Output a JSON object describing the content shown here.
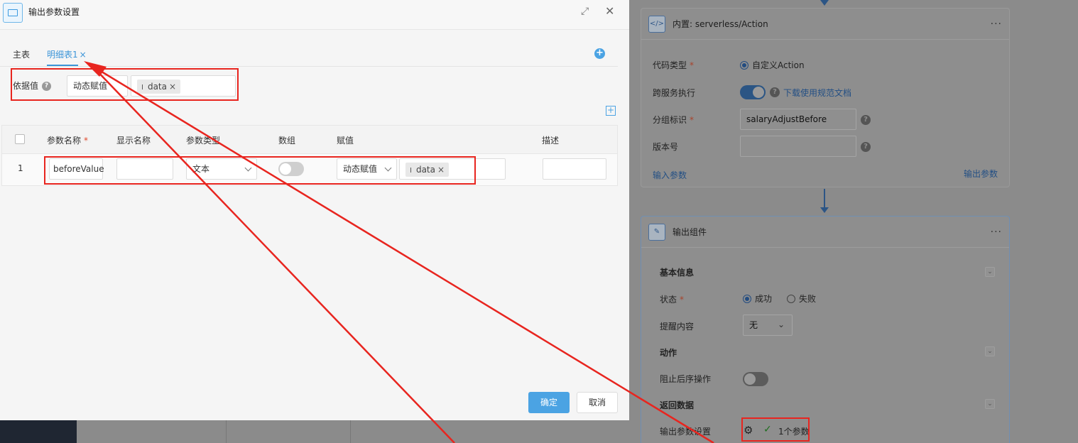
{
  "colors": {
    "accent": "#4ba3e3",
    "annotation": "#e8251f",
    "active_blue": "#3c95d8"
  },
  "modal": {
    "title": "输出参数设置",
    "expand_icon": "expand-icon",
    "close_icon": "close-icon",
    "tabs": [
      {
        "label": "主表"
      },
      {
        "label": "明细表1",
        "close": "×"
      }
    ],
    "add_icon": "+",
    "dependency": {
      "label": "依据值",
      "help": "?",
      "mode": "动态赋值",
      "tag": "data",
      "tag_close": "×"
    },
    "add_row_icon": "+",
    "table": {
      "headers": [
        "参数名称",
        "显示名称",
        "参数类型",
        "数组",
        "赋值",
        "描述"
      ],
      "required_mark": "*",
      "rows": [
        {
          "index": "1",
          "name": "beforeValue",
          "display_name": "",
          "type": "文本",
          "array": false,
          "assign_mode": "动态赋值",
          "assign_tag": "data",
          "assign_close": "×",
          "description": ""
        }
      ]
    },
    "ok_label": "确定",
    "cancel_label": "取消"
  },
  "background": {
    "action_card": {
      "icon_text": "</>",
      "title": "内置: serverless/Action",
      "more": "···",
      "code_type_label": "代码类型",
      "code_type_value": "自定义Action",
      "cross_service_label": "跨服务执行",
      "cross_service_on": true,
      "download_link": "下载使用规范文档",
      "group_label": "分组标识",
      "group_value": "salaryAdjustBefore",
      "version_label": "版本号",
      "version_value": "",
      "input_params": "输入参数",
      "output_params": "输出参数"
    },
    "output_card": {
      "title": "输出组件",
      "more": "···",
      "basic_info": "基本信息",
      "status_label": "状态",
      "status_success": "成功",
      "status_fail": "失败",
      "reminder_label": "提醒内容",
      "reminder_value": "无",
      "action_section": "动作",
      "block_label": "阻止后序操作",
      "block_on": false,
      "return_section": "返回数据",
      "output_setting_label": "输出参数设置",
      "output_count": "1个参数"
    }
  }
}
